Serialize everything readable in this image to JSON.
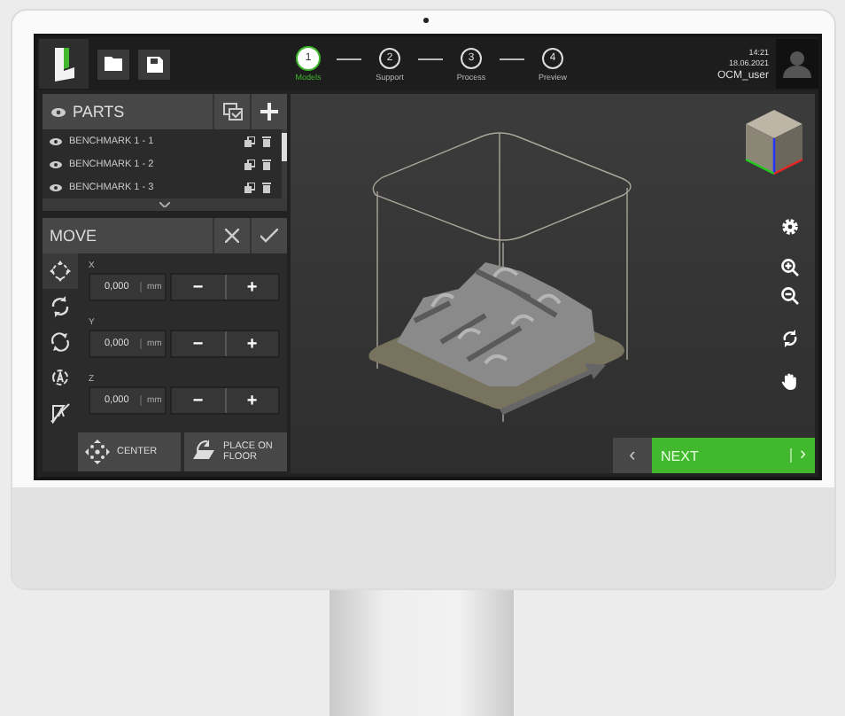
{
  "header": {
    "steps": [
      {
        "number": "1",
        "label": "Models",
        "selected": true
      },
      {
        "number": "2",
        "label": "Support",
        "selected": false
      },
      {
        "number": "3",
        "label": "Process",
        "selected": false
      },
      {
        "number": "4",
        "label": "Preview",
        "selected": false
      }
    ],
    "time": "14:21",
    "date": "18.06.2021",
    "user": "OCM_user"
  },
  "parts_panel": {
    "title": "PARTS",
    "items": [
      {
        "name": "BENCHMARK 1 - 1"
      },
      {
        "name": "BENCHMARK 1 - 2"
      },
      {
        "name": "BENCHMARK 1 - 3"
      }
    ]
  },
  "move_panel": {
    "title": "MOVE",
    "tools": [
      {
        "kind": "move",
        "selected": true
      },
      {
        "kind": "rotate",
        "selected": false
      },
      {
        "kind": "rotate-alt",
        "selected": false
      },
      {
        "kind": "scale",
        "selected": false
      },
      {
        "kind": "mirror",
        "selected": false
      }
    ],
    "axes": [
      {
        "label": "X",
        "value": "0,000",
        "unit": "mm",
        "minus": "−",
        "plus": "+"
      },
      {
        "label": "Y",
        "value": "0,000",
        "unit": "mm",
        "minus": "−",
        "plus": "+"
      },
      {
        "label": "Z",
        "value": "0,000",
        "unit": "mm",
        "minus": "−",
        "plus": "+"
      }
    ],
    "actions": [
      {
        "kind": "center",
        "label": "CENTER"
      },
      {
        "kind": "floor",
        "label": "PLACE ON FLOOR"
      }
    ]
  },
  "footer": {
    "back": "‹",
    "next": "NEXT",
    "next_arrow": "›"
  }
}
